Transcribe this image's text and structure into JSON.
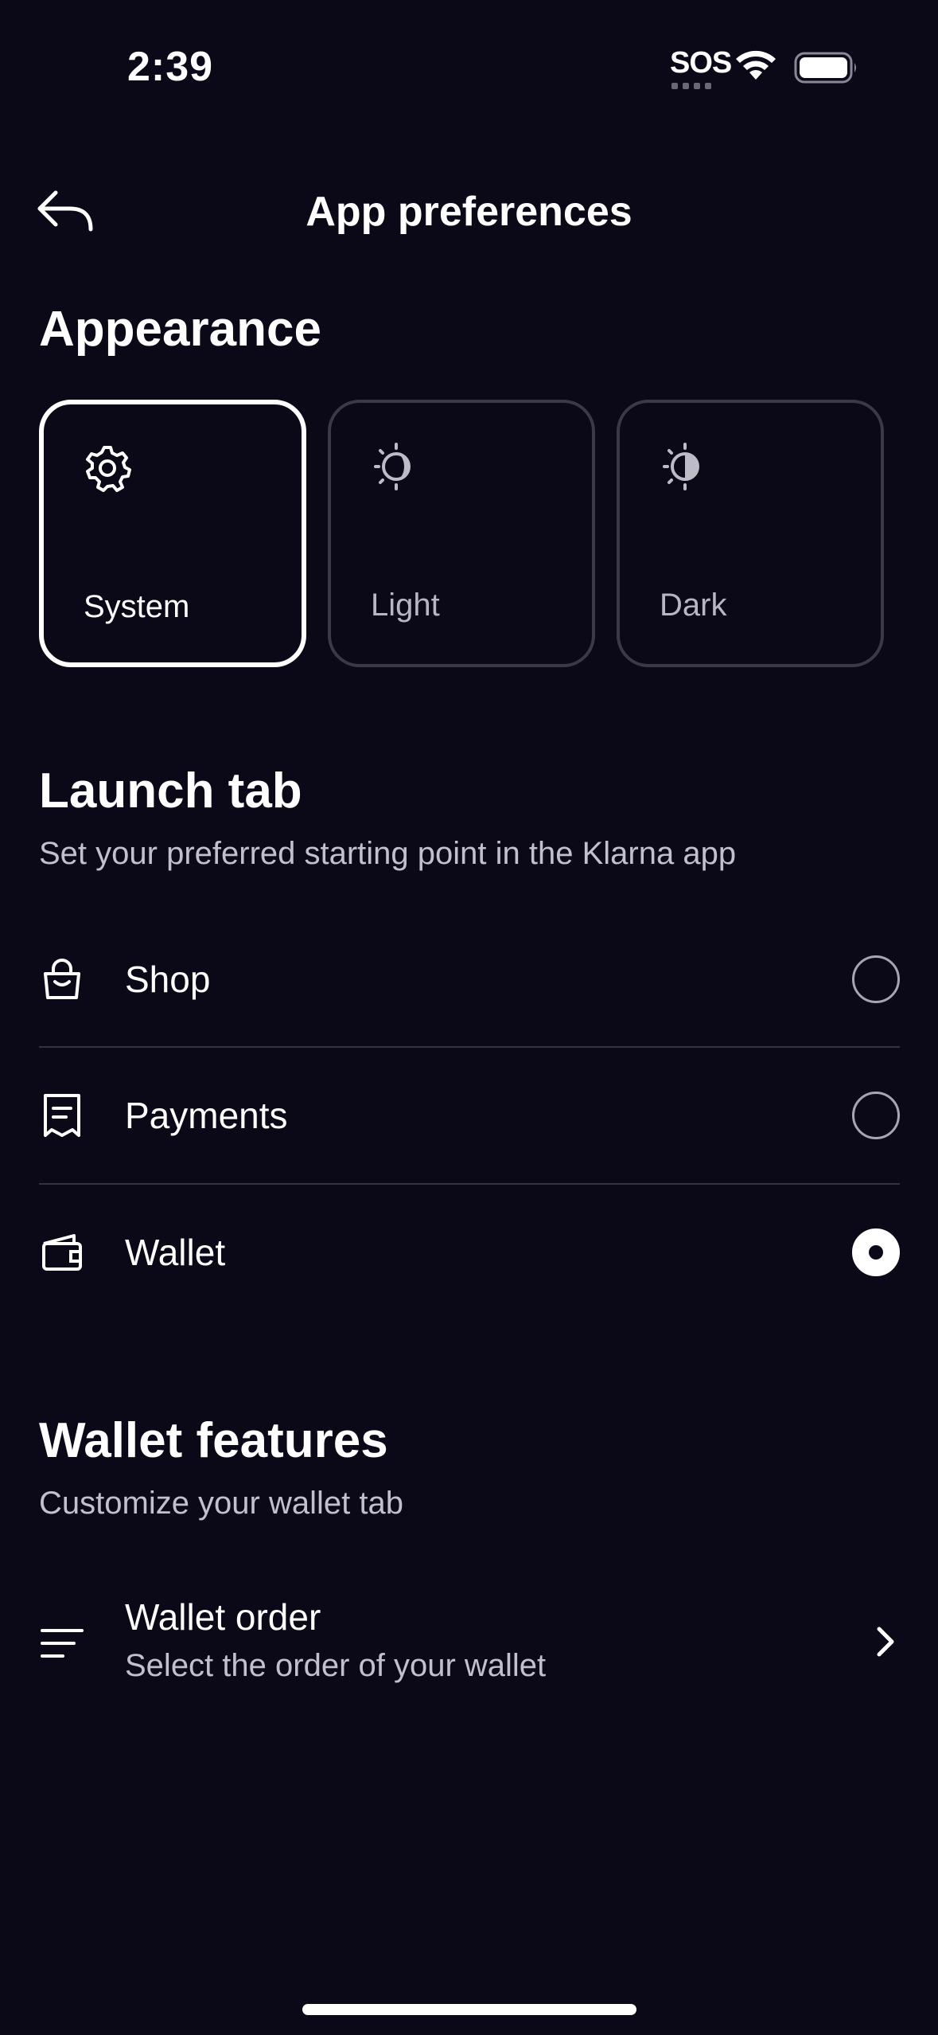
{
  "status_bar": {
    "time": "2:39",
    "sos": "SOS"
  },
  "header": {
    "title": "App preferences"
  },
  "appearance": {
    "title": "Appearance",
    "options": [
      {
        "label": "System",
        "icon": "gear-icon",
        "selected": true
      },
      {
        "label": "Light",
        "icon": "light-mode-icon",
        "selected": false
      },
      {
        "label": "Dark",
        "icon": "dark-mode-icon",
        "selected": false
      }
    ]
  },
  "launch_tab": {
    "title": "Launch tab",
    "subtitle": "Set your preferred starting point in the Klarna app",
    "options": [
      {
        "label": "Shop",
        "icon": "shopping-bag-icon",
        "selected": false
      },
      {
        "label": "Payments",
        "icon": "receipt-icon",
        "selected": false
      },
      {
        "label": "Wallet",
        "icon": "wallet-icon",
        "selected": true
      }
    ]
  },
  "wallet_features": {
    "title": "Wallet features",
    "subtitle": "Customize your wallet tab",
    "wallet_order": {
      "title": "Wallet order",
      "subtitle": "Select the order of your wallet",
      "icon": "sort-lines-icon"
    }
  },
  "colors": {
    "background": "#0b0818",
    "text": "#ffffff",
    "muted_text": "#c2c0cc",
    "border": "#3b3848"
  }
}
